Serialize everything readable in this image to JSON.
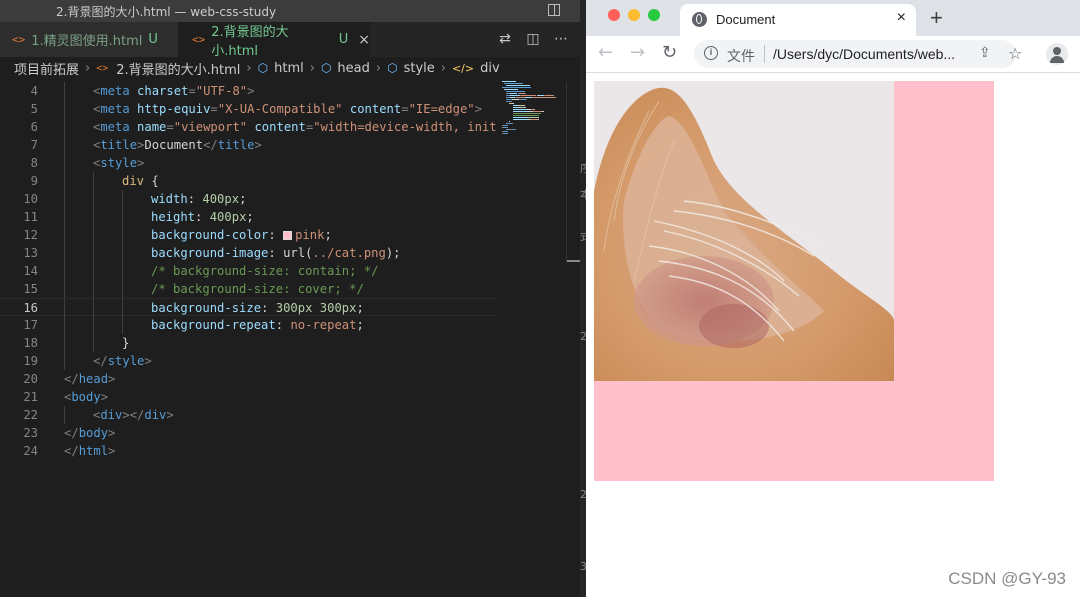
{
  "vscode": {
    "window_title": "2.背景图的大小.html — web-css-study",
    "tabs": [
      {
        "label": "1.精灵图使用.html",
        "status": "U",
        "active": false
      },
      {
        "label": "2.背景图的大小.html",
        "status": "U",
        "active": true,
        "close": "×"
      }
    ],
    "breadcrumb": {
      "folder": "项目前拓展",
      "file": "2.背景图的大小.html",
      "items": [
        "html",
        "head",
        "style",
        "div"
      ]
    },
    "current_line": 16,
    "code_lines": [
      {
        "n": "4",
        "indent": 4,
        "t": [
          [
            "br",
            "<"
          ],
          [
            "tag",
            "meta"
          ],
          [
            "text",
            " "
          ],
          [
            "attr",
            "charset"
          ],
          [
            "br",
            "="
          ],
          [
            "str",
            "\"UTF-8\""
          ],
          [
            "br",
            ">"
          ]
        ]
      },
      {
        "n": "5",
        "indent": 4,
        "t": [
          [
            "br",
            "<"
          ],
          [
            "tag",
            "meta"
          ],
          [
            "text",
            " "
          ],
          [
            "attr",
            "http-equiv"
          ],
          [
            "br",
            "="
          ],
          [
            "str",
            "\"X-UA-Compatible\""
          ],
          [
            "text",
            " "
          ],
          [
            "attr",
            "content"
          ],
          [
            "br",
            "="
          ],
          [
            "str",
            "\"IE=edge\""
          ],
          [
            "br",
            ">"
          ]
        ]
      },
      {
        "n": "6",
        "indent": 4,
        "t": [
          [
            "br",
            "<"
          ],
          [
            "tag",
            "meta"
          ],
          [
            "text",
            " "
          ],
          [
            "attr",
            "name"
          ],
          [
            "br",
            "="
          ],
          [
            "str",
            "\"viewport\""
          ],
          [
            "text",
            " "
          ],
          [
            "attr",
            "content"
          ],
          [
            "br",
            "="
          ],
          [
            "str",
            "\"width=device-width, initi"
          ]
        ]
      },
      {
        "n": "7",
        "indent": 4,
        "t": [
          [
            "br",
            "<"
          ],
          [
            "tag",
            "title"
          ],
          [
            "br",
            ">"
          ],
          [
            "text",
            "Document"
          ],
          [
            "br",
            "</"
          ],
          [
            "tag",
            "title"
          ],
          [
            "br",
            ">"
          ]
        ]
      },
      {
        "n": "8",
        "indent": 4,
        "t": [
          [
            "br",
            "<"
          ],
          [
            "tag",
            "style"
          ],
          [
            "br",
            ">"
          ]
        ]
      },
      {
        "n": "9",
        "indent": 8,
        "t": [
          [
            "sel",
            "div"
          ],
          [
            "punct",
            " {"
          ]
        ]
      },
      {
        "n": "10",
        "indent": 12,
        "t": [
          [
            "prop",
            "width"
          ],
          [
            "punct",
            ": "
          ],
          [
            "num",
            "400px"
          ],
          [
            "punct",
            ";"
          ]
        ]
      },
      {
        "n": "11",
        "indent": 12,
        "t": [
          [
            "prop",
            "height"
          ],
          [
            "punct",
            ": "
          ],
          [
            "num",
            "400px"
          ],
          [
            "punct",
            ";"
          ]
        ]
      },
      {
        "n": "12",
        "indent": 12,
        "t": [
          [
            "prop",
            "background-color"
          ],
          [
            "punct",
            ": "
          ],
          [
            "swatch",
            ""
          ],
          [
            "val",
            "pink"
          ],
          [
            "punct",
            ";"
          ]
        ]
      },
      {
        "n": "13",
        "indent": 12,
        "t": [
          [
            "prop",
            "background-image"
          ],
          [
            "punct",
            ": "
          ],
          [
            "text",
            "url("
          ],
          [
            "val",
            "../cat.png"
          ],
          [
            "text",
            ")"
          ],
          [
            "punct",
            ";"
          ]
        ]
      },
      {
        "n": "14",
        "indent": 12,
        "t": [
          [
            "comment",
            "/* background-size: contain; */"
          ]
        ]
      },
      {
        "n": "15",
        "indent": 12,
        "t": [
          [
            "comment",
            "/* background-size: cover; */"
          ]
        ]
      },
      {
        "n": "16",
        "indent": 12,
        "t": [
          [
            "prop",
            "background-size"
          ],
          [
            "punct",
            ": "
          ],
          [
            "num",
            "300px 300px"
          ],
          [
            "punct",
            ";"
          ]
        ]
      },
      {
        "n": "17",
        "indent": 12,
        "t": [
          [
            "prop",
            "background-repeat"
          ],
          [
            "punct",
            ": "
          ],
          [
            "val",
            "no-repeat"
          ],
          [
            "punct",
            ";"
          ]
        ]
      },
      {
        "n": "18",
        "indent": 8,
        "t": [
          [
            "punct",
            "}"
          ]
        ]
      },
      {
        "n": "19",
        "indent": 4,
        "t": [
          [
            "br",
            "</"
          ],
          [
            "tag",
            "style"
          ],
          [
            "br",
            ">"
          ]
        ]
      },
      {
        "n": "20",
        "indent": 0,
        "t": [
          [
            "br",
            "</"
          ],
          [
            "tag",
            "head"
          ],
          [
            "br",
            ">"
          ]
        ]
      },
      {
        "n": "21",
        "indent": 0,
        "t": [
          [
            "br",
            "<"
          ],
          [
            "tag",
            "body"
          ],
          [
            "br",
            ">"
          ]
        ]
      },
      {
        "n": "22",
        "indent": 4,
        "t": [
          [
            "br",
            "<"
          ],
          [
            "tag",
            "div"
          ],
          [
            "br",
            "></"
          ],
          [
            "tag",
            "div"
          ],
          [
            "br",
            ">"
          ]
        ]
      },
      {
        "n": "23",
        "indent": 0,
        "t": [
          [
            "br",
            "</"
          ],
          [
            "tag",
            "body"
          ],
          [
            "br",
            ">"
          ]
        ]
      },
      {
        "n": "24",
        "indent": 0,
        "t": [
          [
            "br",
            "</"
          ],
          [
            "tag",
            "html"
          ],
          [
            "br",
            ">"
          ]
        ]
      }
    ],
    "divider_glyphs": [
      "序",
      "本",
      "式",
      "2",
      "2",
      "3"
    ]
  },
  "chrome": {
    "tab_title": "Document",
    "tab_close": "×",
    "new_tab": "+",
    "address_scheme": "文件",
    "address_url": "/Users/dyc/Documents/web...",
    "page": {
      "div_background": "#ffc0cb",
      "image_name": "cat.png"
    }
  },
  "watermark": "CSDN @GY-93",
  "colors": {
    "editor_bg": "#1e1e1e",
    "pink": "#ffc0cb",
    "traffic_red": "#ff5f57",
    "traffic_yellow": "#febc2e",
    "traffic_green": "#28c840"
  }
}
